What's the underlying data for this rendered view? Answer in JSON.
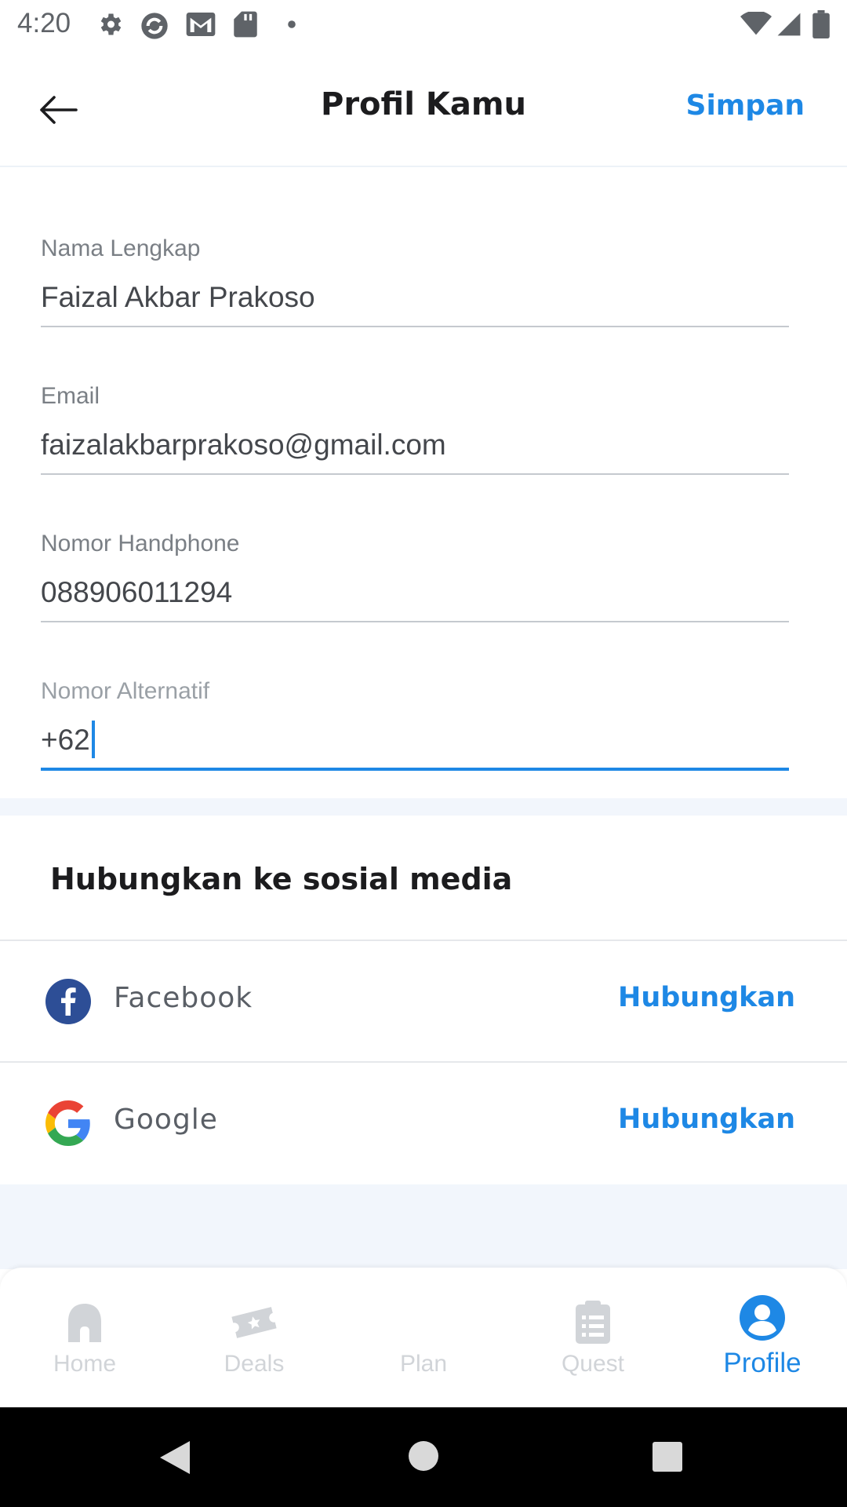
{
  "status_bar": {
    "time": "4:20",
    "icons": [
      "settings-icon",
      "sync-icon",
      "gmail-icon",
      "sd-card-icon",
      "dot-icon",
      "wifi-icon",
      "signal-icon",
      "battery-icon"
    ]
  },
  "app_bar": {
    "back_icon": "arrow-left-icon",
    "title": "Profil Kamu",
    "save_label": "Simpan"
  },
  "form": {
    "fields": [
      {
        "label": "Nama Lengkap",
        "value": "Faizal Akbar Prakoso"
      },
      {
        "label": "Email",
        "value": "faizalakbarprakoso@gmail.com"
      },
      {
        "label": "Nomor Handphone",
        "value": "088906011294"
      },
      {
        "label": "Nomor Alternatif",
        "value": "+62",
        "focused": true
      }
    ]
  },
  "social": {
    "title": "Hubungkan ke sosial media",
    "items": [
      {
        "name": "Facebook",
        "icon": "facebook-icon",
        "action": "Hubungkan"
      },
      {
        "name": "Google",
        "icon": "google-icon",
        "action": "Hubungkan"
      }
    ]
  },
  "bottom_nav": {
    "items": [
      {
        "label": "Home",
        "icon": "home-icon",
        "active": false
      },
      {
        "label": "Deals",
        "icon": "ticket-icon",
        "active": false
      },
      {
        "label": "Plan",
        "icon": "plan-icon",
        "active": false
      },
      {
        "label": "Quest",
        "icon": "clipboard-icon",
        "active": false
      },
      {
        "label": "Profile",
        "icon": "user-circle-icon",
        "active": true
      }
    ]
  },
  "colors": {
    "accent": "#1e88e5",
    "title_text": "#1c1c1e",
    "label_text": "#7a7f85",
    "inactive_nav": "#d1d4d8",
    "section_bg": "#f2f6fc",
    "facebook": "#3b5998"
  }
}
